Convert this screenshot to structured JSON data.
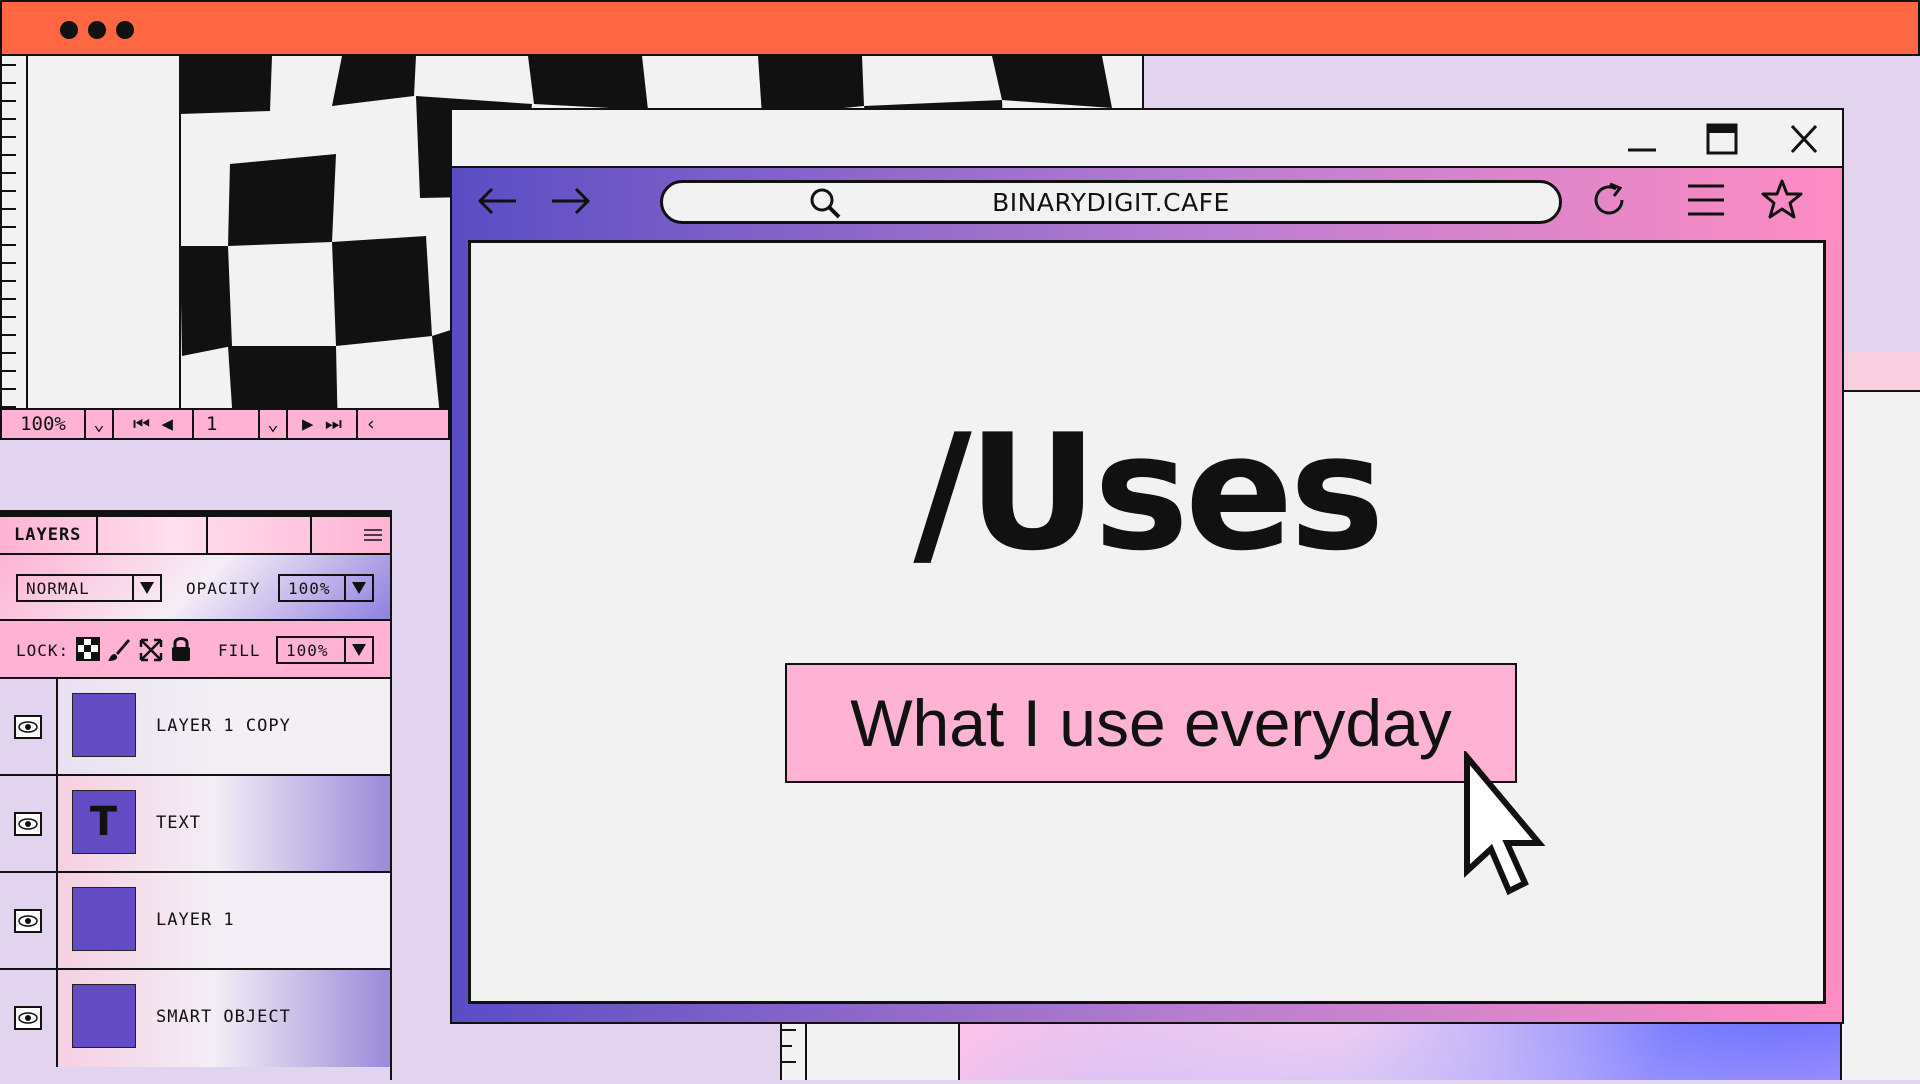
{
  "canvas_nav": {
    "zoom": "100%",
    "page": "1"
  },
  "layers": {
    "title": "LAYERS",
    "blend_mode": "NORMAL",
    "opacity_label": "OPACITY",
    "opacity_value": "100%",
    "lock_label": "LOCK:",
    "fill_label": "FILL",
    "fill_value": "100%",
    "items": [
      {
        "name": "LAYER 1 COPY",
        "thumb": ""
      },
      {
        "name": "TEXT",
        "thumb": "T"
      },
      {
        "name": "LAYER 1",
        "thumb": ""
      },
      {
        "name": "SMART OBJECT",
        "thumb": ""
      }
    ]
  },
  "browser": {
    "url": "BINARYDIGIT.CAFE",
    "heading": "/Uses",
    "cta_label": "What I use everyday"
  },
  "icons": {
    "window_controls": [
      "minimize-icon",
      "maximize-icon",
      "close-icon"
    ],
    "toolbar": [
      "back-arrow-icon",
      "forward-arrow-icon",
      "search-icon",
      "reload-icon",
      "menu-icon",
      "star-icon"
    ]
  },
  "colors": {
    "titlebar": "#ff6641",
    "pink": "#ffb3d4",
    "purple": "#634bc4",
    "background": "#e2d3ef"
  }
}
